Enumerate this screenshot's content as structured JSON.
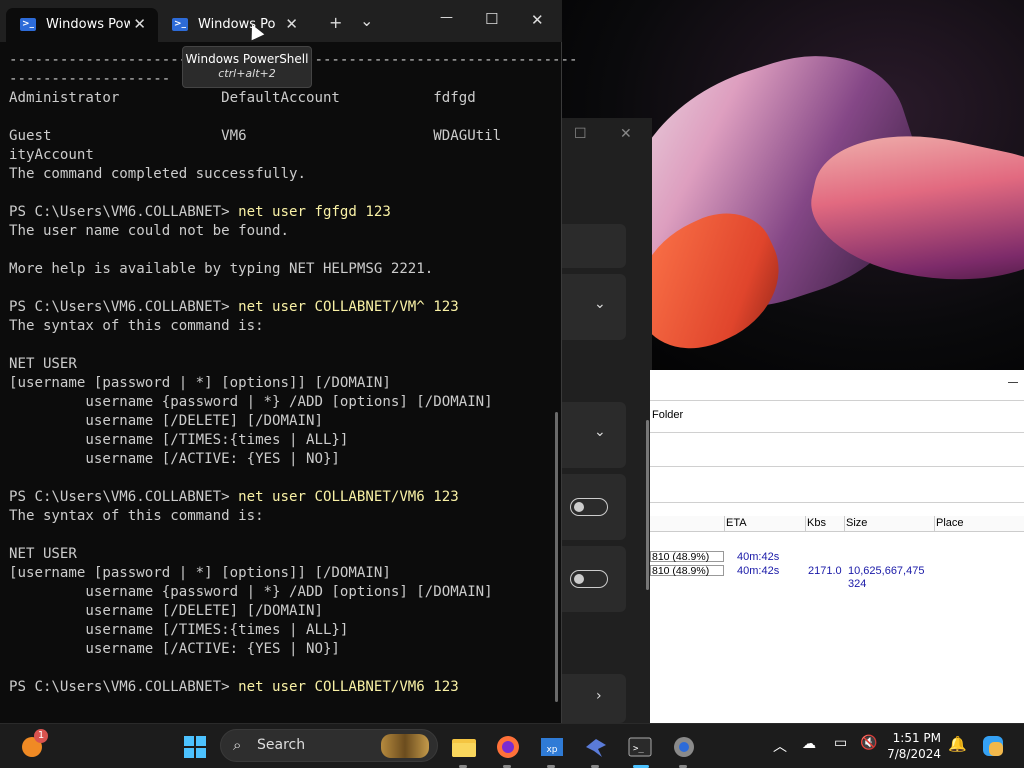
{
  "terminal": {
    "tabs": [
      {
        "label": "Windows PowerShell",
        "active": true
      },
      {
        "label": "Windows PowerShell",
        "active": false
      }
    ],
    "new_tab_glyph": "+",
    "dropdown_glyph": "⌄",
    "minimize_glyph": "—",
    "maximize_glyph": "☐",
    "close_glyph": "✕",
    "tooltip": {
      "title": "Windows PowerShell",
      "shortcut": "ctrl+alt+2"
    },
    "lines": [
      {
        "text": "-------------------------------------------------------------------",
        "cmd": ""
      },
      {
        "text": "-------------------",
        "cmd": ""
      },
      {
        "text": "Administrator            DefaultAccount           fdfgd",
        "cmd": ""
      },
      {
        "text": "",
        "cmd": ""
      },
      {
        "text": "Guest                    VM6                      WDAGUtil",
        "cmd": ""
      },
      {
        "text": "ityAccount",
        "cmd": ""
      },
      {
        "text": "The command completed successfully.",
        "cmd": ""
      },
      {
        "text": "",
        "cmd": ""
      },
      {
        "text": "PS C:\\Users\\VM6.COLLABNET> ",
        "cmd": "net user fgfgd 123"
      },
      {
        "text": "The user name could not be found.",
        "cmd": ""
      },
      {
        "text": "",
        "cmd": ""
      },
      {
        "text": "More help is available by typing NET HELPMSG 2221.",
        "cmd": ""
      },
      {
        "text": "",
        "cmd": ""
      },
      {
        "text": "PS C:\\Users\\VM6.COLLABNET> ",
        "cmd": "net user COLLABNET/VM^ 123"
      },
      {
        "text": "The syntax of this command is:",
        "cmd": ""
      },
      {
        "text": "",
        "cmd": ""
      },
      {
        "text": "NET USER",
        "cmd": ""
      },
      {
        "text": "[username [password | *] [options]] [/DOMAIN]",
        "cmd": ""
      },
      {
        "text": "         username {password | *} /ADD [options] [/DOMAIN]",
        "cmd": ""
      },
      {
        "text": "         username [/DELETE] [/DOMAIN]",
        "cmd": ""
      },
      {
        "text": "         username [/TIMES:{times | ALL}]",
        "cmd": ""
      },
      {
        "text": "         username [/ACTIVE: {YES | NO}]",
        "cmd": ""
      },
      {
        "text": "",
        "cmd": ""
      },
      {
        "text": "PS C:\\Users\\VM6.COLLABNET> ",
        "cmd": "net user COLLABNET/VM6 123"
      },
      {
        "text": "The syntax of this command is:",
        "cmd": ""
      },
      {
        "text": "",
        "cmd": ""
      },
      {
        "text": "NET USER",
        "cmd": ""
      },
      {
        "text": "[username [password | *] [options]] [/DOMAIN]",
        "cmd": ""
      },
      {
        "text": "         username {password | *} /ADD [options] [/DOMAIN]",
        "cmd": ""
      },
      {
        "text": "         username [/DELETE] [/DOMAIN]",
        "cmd": ""
      },
      {
        "text": "         username [/TIMES:{times | ALL}]",
        "cmd": ""
      },
      {
        "text": "         username [/ACTIVE: {YES | NO}]",
        "cmd": ""
      },
      {
        "text": "",
        "cmd": ""
      },
      {
        "text": "PS C:\\Users\\VM6.COLLABNET> ",
        "cmd": "net user COLLABNET/VM6 123"
      }
    ]
  },
  "download_manager": {
    "folder_label": "Folder",
    "columns": [
      "ETA",
      "Kbs",
      "Size",
      "Place"
    ],
    "rows": [
      {
        "progress": "810 (48.9%)",
        "eta": "40m:42s",
        "kbs": "",
        "size": "",
        "extra": ""
      },
      {
        "progress": "810 (48.9%)",
        "eta": "40m:42s",
        "kbs": "2171.0",
        "size": "10,625,667,475",
        "extra": "324"
      }
    ]
  },
  "taskbar": {
    "search_placeholder": "Search",
    "clock_time": "1:51 PM",
    "clock_date": "7/8/2024",
    "weather_badge": "1",
    "apps": [
      "file-explorer",
      "firefox",
      "windows-xp-mode",
      "bird-app",
      "terminal",
      "settings"
    ]
  },
  "colors": {
    "terminal_bg": "#0c0c0c",
    "command_yellow": "#f9f1a5",
    "link_blue": "#1a1aa8"
  }
}
